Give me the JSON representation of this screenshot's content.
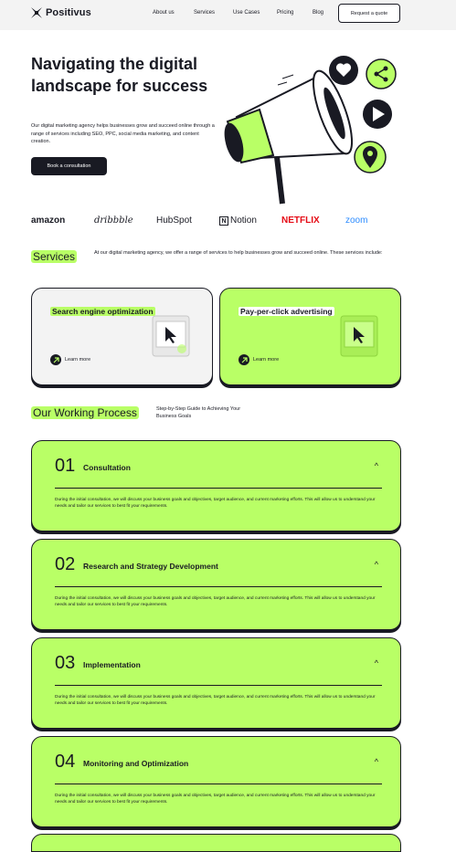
{
  "header": {
    "brand": "Positivus",
    "nav": [
      "About us",
      "Services",
      "Use Cases",
      "Pricing",
      "Blog"
    ],
    "cta": "Request a quote"
  },
  "hero": {
    "title": "Navigating the digital landscape for success",
    "subtitle": "Our digital marketing agency helps businesses grow and succeed online through a range of services including SEO, PPC, social media marketing, and content creation.",
    "cta": "Book a consultation",
    "icons": [
      "heart-icon",
      "share-icon",
      "play-icon",
      "location-pin-icon",
      "megaphone-icon"
    ]
  },
  "brands": [
    "amazon",
    "dribbble",
    "HubSpot",
    "Notion",
    "NETFLIX",
    "zoom"
  ],
  "services": {
    "heading": "Services",
    "description": "At our digital marketing agency, we offer a range of services to help businesses grow and succeed online. These services include:",
    "cards": [
      {
        "title": "Search engine optimization",
        "link": "Learn more"
      },
      {
        "title": "Pay-per-click advertising",
        "link": "Learn more"
      }
    ]
  },
  "process": {
    "heading": "Our Working Process",
    "description": "Step-by-Step Guide to Achieving Your Business Goals",
    "steps": [
      {
        "num": "01",
        "title": "Consultation",
        "body": "During the initial consultation, we will discuss your business goals and objectives, target audience, and current marketing efforts. This will allow us to understand your needs and tailor our services to best fit your requirements."
      },
      {
        "num": "02",
        "title": "Research and Strategy Development",
        "body": "During the initial consultation, we will discuss your business goals and objectives, target audience, and current marketing efforts. This will allow us to understand your needs and tailor our services to best fit your requirements."
      },
      {
        "num": "03",
        "title": "Implementation",
        "body": "During the initial consultation, we will discuss your business goals and objectives, target audience, and current marketing efforts. This will allow us to understand your needs and tailor our services to best fit your requirements."
      },
      {
        "num": "04",
        "title": "Monitoring and Optimization",
        "body": "During the initial consultation, we will discuss your business goals and objectives, target audience, and current marketing efforts. This will allow us to understand your needs and tailor our services to best fit your requirements."
      }
    ],
    "toggle_glyph": "^"
  },
  "colors": {
    "accent": "#B9FF66",
    "dark": "#191A23",
    "grey": "#F3F3F3"
  }
}
